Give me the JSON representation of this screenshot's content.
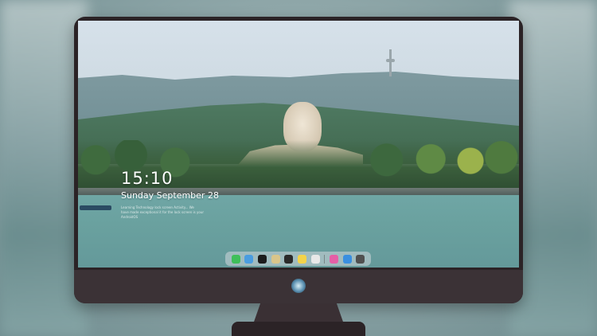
{
  "lockscreen": {
    "time": "15:10",
    "date": "Sunday September 28",
    "notice_line1": "Learning Technology lock screen Activity... We",
    "notice_line2": "have made exceptional it for the lock screen is your AndroidOS"
  },
  "dock": {
    "icons": [
      {
        "name": "messages-icon",
        "color": "#3fbf5a"
      },
      {
        "name": "weather-icon",
        "color": "#4a9de0"
      },
      {
        "name": "clock-icon",
        "color": "#1c1c1c"
      },
      {
        "name": "contacts-icon",
        "color": "#d9c58a"
      },
      {
        "name": "video-icon",
        "color": "#2a2a2a"
      },
      {
        "name": "notes-icon",
        "color": "#f3d34a"
      },
      {
        "name": "photos-icon",
        "color": "#e8e8e8"
      },
      {
        "name": "itunes-icon",
        "color": "#e55fa6"
      },
      {
        "name": "safari-icon",
        "color": "#3a8fe0"
      },
      {
        "name": "camera-icon",
        "color": "#505050"
      }
    ]
  },
  "colors": {
    "bezel": "#2b2326",
    "chin": "#3b3236",
    "water": "#6aa19f"
  }
}
